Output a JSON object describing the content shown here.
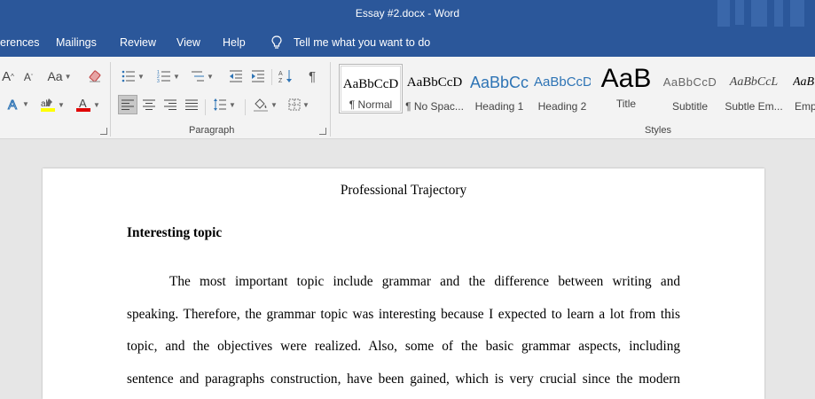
{
  "window": {
    "title": "Essay #2.docx  -  Word"
  },
  "menu": {
    "items": [
      "erences",
      "Mailings",
      "Review",
      "View",
      "Help"
    ],
    "tell_me": "Tell me what you want to do"
  },
  "ribbon": {
    "font_group": {
      "change_case": "Aa",
      "grow": "A",
      "shrink": "A"
    },
    "paragraph_group": {
      "label": "Paragraph"
    },
    "styles_group": {
      "label": "Styles",
      "tiles": [
        {
          "preview": "AaBbCcD",
          "name": "¶ Normal"
        },
        {
          "preview": "AaBbCcD",
          "name": "¶ No Spac..."
        },
        {
          "preview": "AaBbCc",
          "name": "Heading 1"
        },
        {
          "preview": "AaBbCcD",
          "name": "Heading 2"
        },
        {
          "preview": "AaB",
          "name": "Title"
        },
        {
          "preview": "AaBbCcD",
          "name": "Subtitle"
        },
        {
          "preview": "AaBbCcL",
          "name": "Subtle Em..."
        },
        {
          "preview": "AaBl",
          "name": "Emp"
        }
      ]
    }
  },
  "document": {
    "title": "Professional Trajectory",
    "heading": "Interesting topic",
    "lines": [
      "The most important topic include grammar and the difference between writing and",
      "speaking. Therefore, the grammar topic was interesting because I expected to learn a lot from this",
      "topic, and the objectives were realized. Also, some of the basic grammar aspects, including",
      "sentence and paragraphs construction, have been gained, which is very crucial since the modern"
    ]
  },
  "colors": {
    "accent": "#2b579a",
    "ribbon": "#f3f3f3",
    "canvas": "#e6e6e6",
    "heading_blue": "#2e74b5"
  }
}
